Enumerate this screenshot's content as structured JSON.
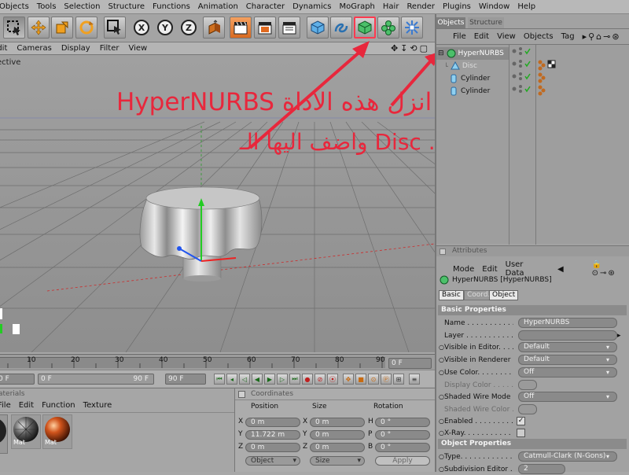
{
  "menubar": {
    "items": [
      "Objects",
      "Tools",
      "Selection",
      "Structure",
      "Functions",
      "Animation",
      "Character",
      "Dynamics",
      "MoGraph",
      "Hair",
      "Render",
      "Plugins",
      "Window",
      "Help"
    ]
  },
  "viewport": {
    "menu": [
      "Edit",
      "Cameras",
      "Display",
      "Filter",
      "View"
    ],
    "label": "ective"
  },
  "timeline": {
    "ticks": [
      "0",
      "10",
      "20",
      "30",
      "40",
      "50",
      "60",
      "70",
      "80",
      "90"
    ],
    "frame_field": "0 F"
  },
  "transport": {
    "start_field": "0 F",
    "end_field": "90 F",
    "max_field": "90 F"
  },
  "materials": {
    "tab_label": "aterials",
    "menu": [
      "File",
      "Edit",
      "Function",
      "Texture"
    ],
    "items": [
      {
        "label": "Mat"
      },
      {
        "label": "Mat"
      }
    ]
  },
  "coords": {
    "title": "Coordinates",
    "headers": [
      "Position",
      "Size",
      "Rotation"
    ],
    "rows": [
      {
        "axis": "X",
        "pos": "0 m",
        "size_axis": "X",
        "size": "0 m",
        "rot_axis": "H",
        "rot": "0 °"
      },
      {
        "axis": "Y",
        "pos": "11.722 m",
        "size_axis": "Y",
        "size": "0 m",
        "rot_axis": "P",
        "rot": "0 °"
      },
      {
        "axis": "Z",
        "pos": "0 m",
        "size_axis": "Z",
        "size": "0 m",
        "rot_axis": "B",
        "rot": "0 °"
      }
    ],
    "mode_select": "Object",
    "size_select": "Size",
    "apply_label": "Apply"
  },
  "objects_panel": {
    "tabs": [
      "Objects",
      "Structure"
    ],
    "menu": [
      "File",
      "Edit",
      "View",
      "Objects",
      "Tag"
    ],
    "tree": [
      {
        "name": "HyperNURBS",
        "icon": "hypernurbs-icon",
        "indent": 0
      },
      {
        "name": "Disc",
        "icon": "disc-icon",
        "indent": 1
      },
      {
        "name": "Cylinder",
        "icon": "cylinder-icon",
        "indent": 0
      },
      {
        "name": "Cylinder",
        "icon": "cylinder-icon",
        "indent": 0
      }
    ]
  },
  "attributes": {
    "title": "Attributes",
    "menu": [
      "Mode",
      "Edit",
      "User Data"
    ],
    "object_title": "HyperNURBS [HyperNURBS]",
    "tabs": [
      "Basic",
      "Coord.",
      "Object"
    ],
    "basic_header": "Basic Properties",
    "basic": [
      {
        "label": "Name . . . . . . . . . . . .",
        "value": "HyperNURBS"
      },
      {
        "label": "Layer . . . . . . . . . . . .",
        "value": ""
      },
      {
        "label": "Visible in Editor. . . . .",
        "value": "Default"
      },
      {
        "label": "Visible in Renderer . .",
        "value": "Default"
      },
      {
        "label": "Use Color. . . . . . . . . .",
        "value": "Off"
      },
      {
        "label": "Display Color . . . . . . .",
        "value": ""
      },
      {
        "label": "Shaded Wire Mode . . .",
        "value": "Off"
      },
      {
        "label": "Shaded Wire Color . . .",
        "value": ""
      },
      {
        "label": "Enabled . . . . . . . . . .",
        "value": ""
      },
      {
        "label": "X-Ray. . . . . . . . . . . .",
        "value": ""
      }
    ],
    "object_header": "Object Properties",
    "object": [
      {
        "label": "Type. . . . . . . . . . . . .",
        "value": "Catmull-Clark (N-Gons)"
      },
      {
        "label": "Subdivision Editor . . .",
        "value": "2"
      }
    ]
  },
  "annotation": {
    "line1": "HyperNURBS انزل هذه الاداة",
    "line2": "واضف اليها الـ Disc .",
    "color": "#e8273c"
  }
}
